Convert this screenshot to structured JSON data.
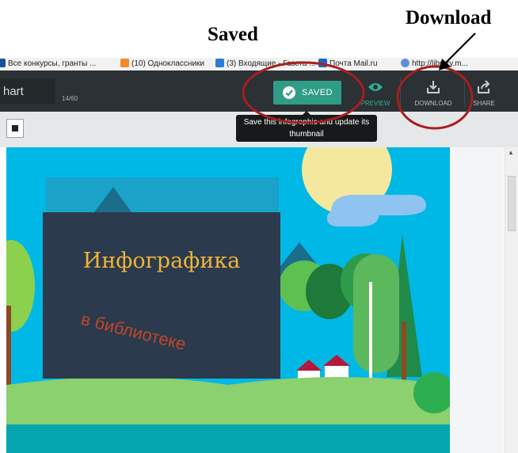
{
  "annotations": {
    "saved": "Saved",
    "download": "Download"
  },
  "bookmarks": [
    {
      "label": "Все конкурсы, гранты ...",
      "color": "#1c4fa0"
    },
    {
      "label": "(10) Одноклассники",
      "color": "#f08a24"
    },
    {
      "label": "(3) Входящие - Газета ...",
      "color": "#2e7bd6"
    },
    {
      "label": "Почта Mail.ru",
      "color": "#1e65c8"
    },
    {
      "label": "http://library.m...",
      "color": "#5f8fd8"
    }
  ],
  "toolbar": {
    "title_value": "hart",
    "char_counter": "14/60",
    "saved_label": "SAVED",
    "preview_label": "PREVIEW",
    "download_label": "DOWNLOAD",
    "share_label": "SHARE"
  },
  "tooltip": {
    "text": "Save this infographic and update its thumbnail"
  },
  "infographic": {
    "title": "Инфографика",
    "subtitle": "в библиотеке"
  },
  "colors": {
    "accent": "#2f9c86",
    "toolbar": "#2b3135",
    "annotation": "#a81e1e",
    "sky": "#00b8e6"
  }
}
